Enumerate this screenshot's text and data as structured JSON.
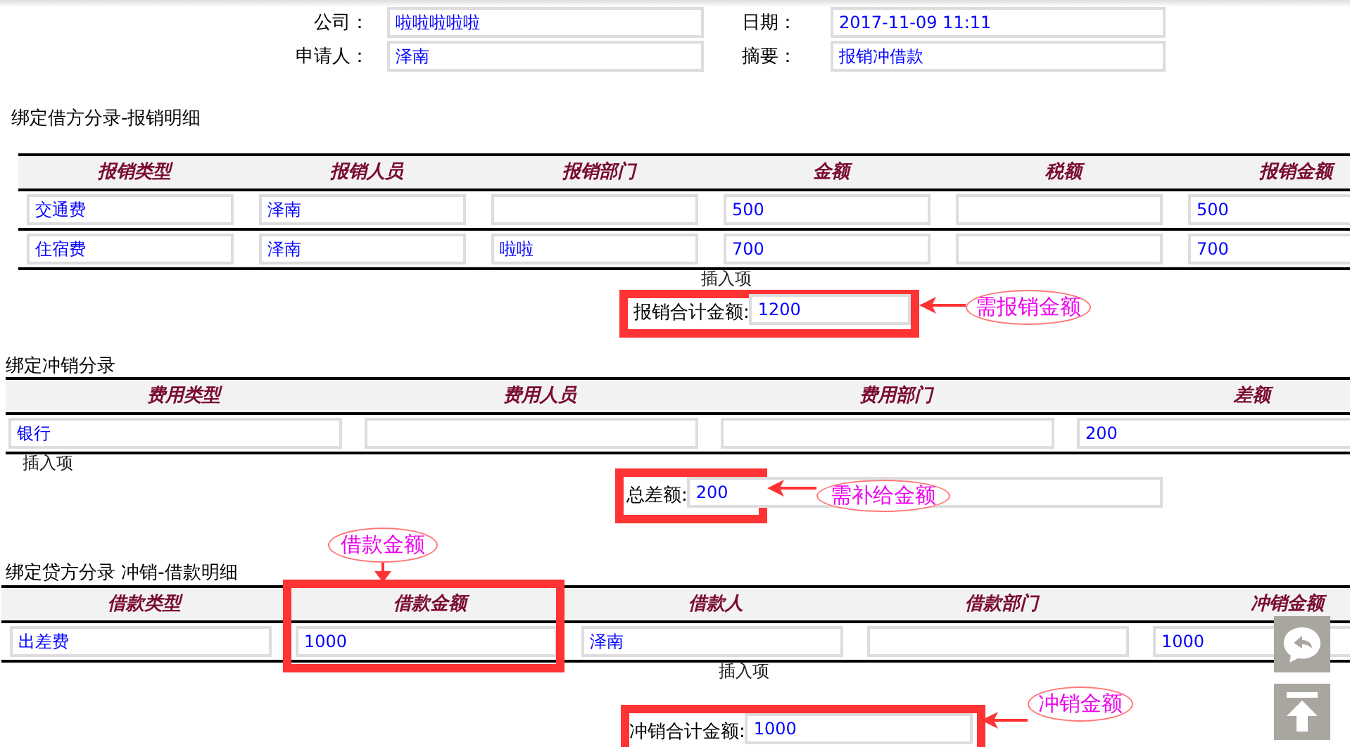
{
  "header_fields": [
    {
      "label": "公司：",
      "value": "啦啦啦啦啦"
    },
    {
      "label": "日期：",
      "value": "2017-11-09 11:11"
    },
    {
      "label": "申请人：",
      "value": "泽南"
    },
    {
      "label": "摘要：",
      "value": "报销冲借款"
    }
  ],
  "sections": [
    {
      "title": "绑定借方分录-报销明细",
      "columns": [
        {
          "label": "报销类型",
          "highlighted": false
        },
        {
          "label": "报销人员",
          "highlighted": false
        },
        {
          "label": "报销部门",
          "highlighted": false
        },
        {
          "label": "金额",
          "highlighted": false
        },
        {
          "label": "税额",
          "highlighted": false
        },
        {
          "label": "报销金额",
          "highlighted": false
        }
      ],
      "rows": [
        [
          "交通费",
          "泽南",
          null,
          "500",
          null,
          "500"
        ],
        [
          "住宿费",
          "泽南",
          "啦啦",
          "700",
          null,
          "700"
        ]
      ],
      "insert_label": "插入项",
      "total": {
        "label": "报销合计金额:",
        "value": "1200",
        "highlighted": true,
        "callout": "需报销金额"
      }
    },
    {
      "title": "绑定冲销分录",
      "columns": [
        {
          "label": "费用类型",
          "highlighted": false
        },
        {
          "label": "费用人员",
          "highlighted": false
        },
        {
          "label": "费用部门",
          "highlighted": false
        },
        {
          "label": "差额",
          "highlighted": false
        }
      ],
      "rows": [
        [
          "银行",
          null,
          null,
          "200"
        ]
      ],
      "insert_label": "插入项",
      "total": {
        "label": "总差额:",
        "value": "200",
        "highlighted": true,
        "callout": "需补给金额"
      }
    },
    {
      "title": "绑定贷方分录 冲销-借款明细",
      "columns": [
        {
          "label": "借款类型",
          "highlighted": false
        },
        {
          "label": "借款金额",
          "highlighted": true,
          "callout": "借款金额"
        },
        {
          "label": "借款人",
          "highlighted": false
        },
        {
          "label": "借款部门",
          "highlighted": false
        },
        {
          "label": "冲销金额",
          "highlighted": false
        }
      ],
      "rows": [
        [
          "出差费",
          "1000",
          "泽南",
          null,
          "1000"
        ]
      ],
      "insert_label": "插入项",
      "total": {
        "label": "冲销合计金额:",
        "value": "1000",
        "highlighted": true,
        "callout": "冲销金额"
      }
    }
  ]
}
